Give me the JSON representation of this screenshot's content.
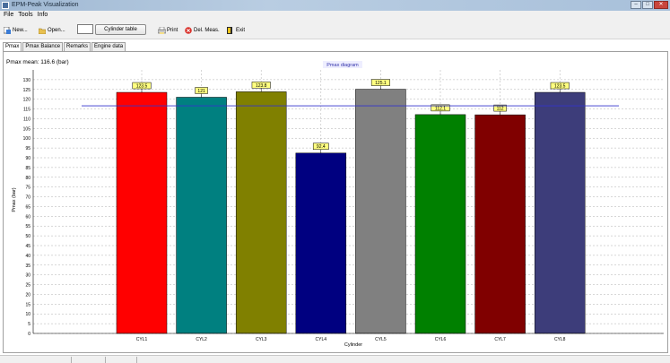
{
  "window": {
    "title": "EPM-Peak Visualization"
  },
  "menu": [
    {
      "label": "File"
    },
    {
      "label": "Tools"
    },
    {
      "label": "Info"
    }
  ],
  "toolbar": {
    "new_label": "New...",
    "open_label": "Open...",
    "cylinder_table_label": "Cylinder table",
    "print_label": "Print",
    "del_meas_label": "Del. Meas.",
    "exit_label": "Exit"
  },
  "tabs": [
    {
      "label": "Pmax"
    },
    {
      "label": "Pmax Balance"
    },
    {
      "label": "Remarks"
    },
    {
      "label": "Engine data"
    }
  ],
  "chart_data": {
    "type": "bar",
    "title": "Pmax diagram",
    "subtitle": "Pmax mean: 116.6  (bar)",
    "xlabel": "Cylinder",
    "ylabel": "Pmax (bar)",
    "categories": [
      "CYL1",
      "CYL2",
      "CYL3",
      "CYL4",
      "CYL5",
      "CYL6",
      "CYL7",
      "CYL8"
    ],
    "values": [
      123.5,
      121,
      123.8,
      92.4,
      125.1,
      112.1,
      112,
      123.5
    ],
    "value_labels": [
      "123.5",
      "121",
      "123.8",
      "92.4",
      "125.1",
      "112.1",
      "112",
      "123.5"
    ],
    "colors": [
      "#ff0000",
      "#008080",
      "#808000",
      "#000080",
      "#808080",
      "#008000",
      "#800000",
      "#3d3d7a"
    ],
    "mean": 116.6,
    "mean_color": "#3333cc",
    "ylim": [
      0,
      135
    ],
    "yticks": [
      0,
      5,
      10,
      15,
      20,
      25,
      30,
      35,
      40,
      45,
      50,
      55,
      60,
      65,
      70,
      75,
      80,
      85,
      90,
      95,
      100,
      105,
      110,
      115,
      120,
      125,
      130
    ],
    "grid": true,
    "label_bg": "#ffff80"
  }
}
